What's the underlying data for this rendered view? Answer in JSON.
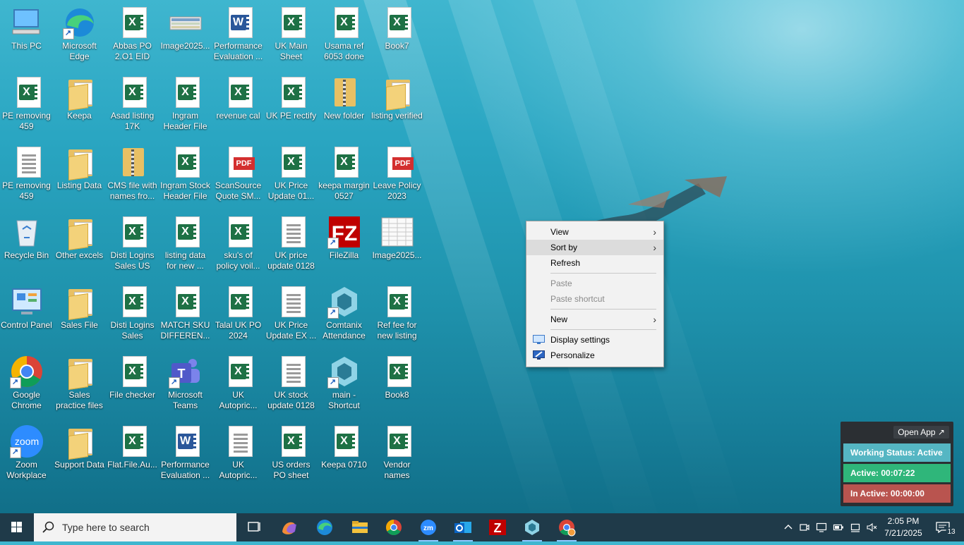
{
  "desktop": {
    "icons": [
      {
        "label": "This PC",
        "type": "pc",
        "col": 0,
        "row": 0
      },
      {
        "label": "Microsoft Edge",
        "type": "edge",
        "col": 1,
        "row": 0
      },
      {
        "label": "Abbas PO 2.O1  EID",
        "type": "excel",
        "col": 2,
        "row": 0
      },
      {
        "label": "Image2025...",
        "type": "image",
        "col": 3,
        "row": 0
      },
      {
        "label": "Performance Evaluation ...",
        "type": "word",
        "col": 4,
        "row": 0
      },
      {
        "label": "UK Main Sheet",
        "type": "excel",
        "col": 5,
        "row": 0
      },
      {
        "label": "Usama ref 6053 done",
        "type": "excel",
        "col": 6,
        "row": 0
      },
      {
        "label": "Book7",
        "type": "excel",
        "col": 7,
        "row": 0
      },
      {
        "label": "PE removing 459",
        "type": "excel",
        "col": 0,
        "row": 1
      },
      {
        "label": "Keepa",
        "type": "folder",
        "col": 1,
        "row": 1
      },
      {
        "label": "Asad listing 17K",
        "type": "excel",
        "col": 2,
        "row": 1
      },
      {
        "label": "Ingram Header File",
        "type": "excel",
        "col": 3,
        "row": 1
      },
      {
        "label": "revenue cal",
        "type": "excel",
        "col": 4,
        "row": 1
      },
      {
        "label": "UK PE rectify",
        "type": "excel",
        "col": 5,
        "row": 1
      },
      {
        "label": "New folder",
        "type": "zipfolder",
        "col": 6,
        "row": 1
      },
      {
        "label": "listing verified",
        "type": "folder",
        "col": 7,
        "row": 1
      },
      {
        "label": "PE removing 459",
        "type": "doc",
        "col": 0,
        "row": 2
      },
      {
        "label": "Listing Data",
        "type": "folder",
        "col": 1,
        "row": 2
      },
      {
        "label": "CMS file with names fro...",
        "type": "zipfolder",
        "col": 2,
        "row": 2
      },
      {
        "label": "Ingram Stock Header File",
        "type": "excel",
        "col": 3,
        "row": 2
      },
      {
        "label": "ScanSource Quote SM...",
        "type": "pdf",
        "col": 4,
        "row": 2
      },
      {
        "label": "UK Price Update 01...",
        "type": "excel",
        "col": 5,
        "row": 2
      },
      {
        "label": "keepa margin 0527",
        "type": "excel",
        "col": 6,
        "row": 2
      },
      {
        "label": "Leave Policy 2023",
        "type": "pdf",
        "col": 7,
        "row": 2
      },
      {
        "label": "Recycle Bin",
        "type": "recycle",
        "col": 0,
        "row": 3
      },
      {
        "label": "Other excels",
        "type": "folder",
        "col": 1,
        "row": 3
      },
      {
        "label": "Disti Logins Sales US",
        "type": "excel",
        "col": 2,
        "row": 3
      },
      {
        "label": "listing data for new ...",
        "type": "excel",
        "col": 3,
        "row": 3
      },
      {
        "label": "sku's of policy voil...",
        "type": "excel",
        "col": 4,
        "row": 3
      },
      {
        "label": "UK price update 0128",
        "type": "doc",
        "col": 5,
        "row": 3
      },
      {
        "label": "FileZilla",
        "type": "filezilla",
        "col": 6,
        "row": 3
      },
      {
        "label": "Image2025...",
        "type": "sheetimg",
        "col": 7,
        "row": 3
      },
      {
        "label": "Control Panel",
        "type": "control",
        "col": 0,
        "row": 4
      },
      {
        "label": "Sales File",
        "type": "folder",
        "col": 1,
        "row": 4
      },
      {
        "label": "Disti Logins Sales",
        "type": "excel",
        "col": 2,
        "row": 4
      },
      {
        "label": "MATCH SKU DIFFEREN...",
        "type": "excel",
        "col": 3,
        "row": 4
      },
      {
        "label": "Talal UK PO 2024",
        "type": "excel",
        "col": 4,
        "row": 4
      },
      {
        "label": "UK Price Update EX ...",
        "type": "doc",
        "col": 5,
        "row": 4
      },
      {
        "label": "Comtanix Attendance",
        "type": "comtanix",
        "col": 6,
        "row": 4
      },
      {
        "label": "Ref fee for new listing",
        "type": "excel",
        "col": 7,
        "row": 4
      },
      {
        "label": "Google Chrome",
        "type": "chrome",
        "col": 0,
        "row": 5
      },
      {
        "label": "Sales practice files",
        "type": "folder",
        "col": 1,
        "row": 5
      },
      {
        "label": "File checker",
        "type": "excel",
        "col": 2,
        "row": 5
      },
      {
        "label": "Microsoft Teams",
        "type": "teams",
        "col": 3,
        "row": 5
      },
      {
        "label": "UK Autopric...",
        "type": "excel",
        "col": 4,
        "row": 5
      },
      {
        "label": "UK stock update 0128",
        "type": "doc",
        "col": 5,
        "row": 5
      },
      {
        "label": "main - Shortcut",
        "type": "comtanix",
        "col": 6,
        "row": 5
      },
      {
        "label": "Book8",
        "type": "excel",
        "col": 7,
        "row": 5
      },
      {
        "label": "Zoom Workplace",
        "type": "zoom",
        "col": 0,
        "row": 6
      },
      {
        "label": "Support Data",
        "type": "folder",
        "col": 1,
        "row": 6
      },
      {
        "label": "Flat.File.Au...",
        "type": "excel",
        "col": 2,
        "row": 6
      },
      {
        "label": "Performance Evaluation ...",
        "type": "word",
        "col": 3,
        "row": 6
      },
      {
        "label": "UK Autopric...",
        "type": "doc",
        "col": 4,
        "row": 6
      },
      {
        "label": "US orders PO sheet",
        "type": "excel",
        "col": 5,
        "row": 6
      },
      {
        "label": "Keepa 0710",
        "type": "excel",
        "col": 6,
        "row": 6
      },
      {
        "label": "Vendor names",
        "type": "excel",
        "col": 7,
        "row": 6
      }
    ]
  },
  "context_menu": {
    "view": "View",
    "sort_by": "Sort by",
    "refresh": "Refresh",
    "paste": "Paste",
    "paste_shortcut": "Paste shortcut",
    "new": "New",
    "display_settings": "Display settings",
    "personalize": "Personalize"
  },
  "widget": {
    "open_app": "Open App ↗",
    "working_status": "Working Status: Active",
    "active": "Active: 00:07:22",
    "inactive": "In Active: 00:00:00",
    "colors": {
      "status": "#55b6c3",
      "active": "#2fb67a",
      "inactive": "#b9544f"
    }
  },
  "taskbar": {
    "search_placeholder": "Type here to search",
    "pinned": [
      "task-view",
      "copilot",
      "edge",
      "file-explorer",
      "chrome",
      "zoom",
      "outlook",
      "filezilla",
      "comtanix",
      "chrome-alt"
    ],
    "time": "2:05 PM",
    "date": "7/21/2025",
    "notifications": "13"
  }
}
